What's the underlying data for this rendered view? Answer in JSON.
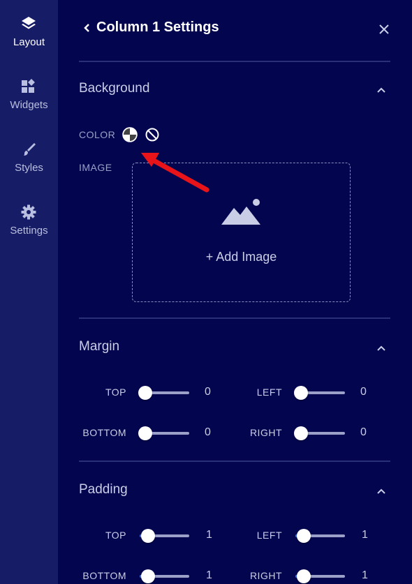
{
  "sidebar": {
    "items": [
      {
        "label": "Layout",
        "icon": "layers-icon",
        "active": true
      },
      {
        "label": "Widgets",
        "icon": "widgets-icon"
      },
      {
        "label": "Styles",
        "icon": "brush-icon"
      },
      {
        "label": "Settings",
        "icon": "gear-icon"
      }
    ]
  },
  "header": {
    "title": "Column 1 Settings"
  },
  "background": {
    "title": "Background",
    "color_label": "COLOR",
    "image_label": "IMAGE",
    "add_image": "+ Add Image"
  },
  "margin": {
    "title": "Margin",
    "top": {
      "label": "TOP",
      "value": "0"
    },
    "left": {
      "label": "LEFT",
      "value": "0"
    },
    "bottom": {
      "label": "BOTTOM",
      "value": "0"
    },
    "right": {
      "label": "RIGHT",
      "value": "0"
    }
  },
  "padding": {
    "title": "Padding",
    "top": {
      "label": "TOP",
      "value": "1"
    },
    "left": {
      "label": "LEFT",
      "value": "1"
    },
    "bottom": {
      "label": "BOTTOM",
      "value": "1"
    },
    "right": {
      "label": "RIGHT",
      "value": "1"
    }
  },
  "colors": {
    "sidebar_bg": "#171c66",
    "panel_bg": "#03064f",
    "annotation_arrow": "#e8141a",
    "slider_fill": "#3d6cf0"
  }
}
